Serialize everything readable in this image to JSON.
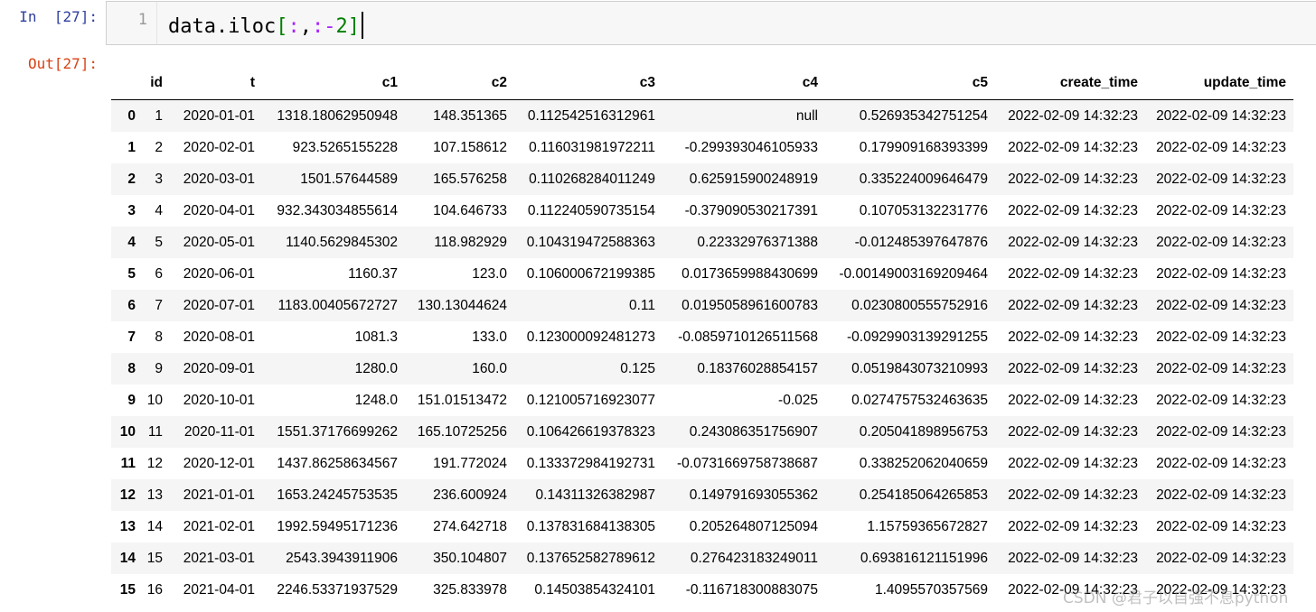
{
  "input_prompt": "In  [27]:",
  "output_prompt": "Out[27]:",
  "editor": {
    "line_number": "1",
    "code_name": "data.iloc",
    "code_open": "[",
    "code_mid1": ":",
    "code_comma": ",",
    "code_mid2": ":",
    "code_minus": "-",
    "code_num": "2",
    "code_close": "]"
  },
  "table": {
    "columns": [
      "",
      "id",
      "t",
      "c1",
      "c2",
      "c3",
      "c4",
      "c5",
      "create_time",
      "update_time"
    ],
    "rows": [
      [
        "0",
        "1",
        "2020-01-01",
        "1318.18062950948",
        "148.351365",
        "0.112542516312961",
        "null",
        "0.526935342751254",
        "2022-02-09 14:32:23",
        "2022-02-09 14:32:23"
      ],
      [
        "1",
        "2",
        "2020-02-01",
        "923.5265155228",
        "107.158612",
        "0.116031981972211",
        "-0.299393046105933",
        "0.179909168393399",
        "2022-02-09 14:32:23",
        "2022-02-09 14:32:23"
      ],
      [
        "2",
        "3",
        "2020-03-01",
        "1501.57644589",
        "165.576258",
        "0.110268284011249",
        "0.625915900248919",
        "0.335224009646479",
        "2022-02-09 14:32:23",
        "2022-02-09 14:32:23"
      ],
      [
        "3",
        "4",
        "2020-04-01",
        "932.343034855614",
        "104.646733",
        "0.112240590735154",
        "-0.379090530217391",
        "0.107053132231776",
        "2022-02-09 14:32:23",
        "2022-02-09 14:32:23"
      ],
      [
        "4",
        "5",
        "2020-05-01",
        "1140.5629845302",
        "118.982929",
        "0.104319472588363",
        "0.22332976371388",
        "-0.012485397647876",
        "2022-02-09 14:32:23",
        "2022-02-09 14:32:23"
      ],
      [
        "5",
        "6",
        "2020-06-01",
        "1160.37",
        "123.0",
        "0.106000672199385",
        "0.0173659988430699",
        "-0.00149003169209464",
        "2022-02-09 14:32:23",
        "2022-02-09 14:32:23"
      ],
      [
        "6",
        "7",
        "2020-07-01",
        "1183.00405672727",
        "130.13044624",
        "0.11",
        "0.0195058961600783",
        "0.0230800555752916",
        "2022-02-09 14:32:23",
        "2022-02-09 14:32:23"
      ],
      [
        "7",
        "8",
        "2020-08-01",
        "1081.3",
        "133.0",
        "0.123000092481273",
        "-0.0859710126511568",
        "-0.0929903139291255",
        "2022-02-09 14:32:23",
        "2022-02-09 14:32:23"
      ],
      [
        "8",
        "9",
        "2020-09-01",
        "1280.0",
        "160.0",
        "0.125",
        "0.18376028854157",
        "0.0519843073210993",
        "2022-02-09 14:32:23",
        "2022-02-09 14:32:23"
      ],
      [
        "9",
        "10",
        "2020-10-01",
        "1248.0",
        "151.01513472",
        "0.121005716923077",
        "-0.025",
        "0.0274757532463635",
        "2022-02-09 14:32:23",
        "2022-02-09 14:32:23"
      ],
      [
        "10",
        "11",
        "2020-11-01",
        "1551.37176699262",
        "165.10725256",
        "0.106426619378323",
        "0.243086351756907",
        "0.205041898956753",
        "2022-02-09 14:32:23",
        "2022-02-09 14:32:23"
      ],
      [
        "11",
        "12",
        "2020-12-01",
        "1437.86258634567",
        "191.772024",
        "0.133372984192731",
        "-0.0731669758738687",
        "0.338252062040659",
        "2022-02-09 14:32:23",
        "2022-02-09 14:32:23"
      ],
      [
        "12",
        "13",
        "2021-01-01",
        "1653.24245753535",
        "236.600924",
        "0.14311326382987",
        "0.149791693055362",
        "0.254185064265853",
        "2022-02-09 14:32:23",
        "2022-02-09 14:32:23"
      ],
      [
        "13",
        "14",
        "2021-02-01",
        "1992.59495171236",
        "274.642718",
        "0.137831684138305",
        "0.205264807125094",
        "1.15759365672827",
        "2022-02-09 14:32:23",
        "2022-02-09 14:32:23"
      ],
      [
        "14",
        "15",
        "2021-03-01",
        "2543.3943911906",
        "350.104807",
        "0.137652582789612",
        "0.276423183249011",
        "0.693816121151996",
        "2022-02-09 14:32:23",
        "2022-02-09 14:32:23"
      ],
      [
        "15",
        "16",
        "2021-04-01",
        "2246.53371937529",
        "325.833978",
        "0.14503854324101",
        "-0.116718300883075",
        "1.4095570357569",
        "2022-02-09 14:32:23",
        "2022-02-09 14:32:23"
      ]
    ]
  },
  "watermark": "CSDN @君子以自强不息python"
}
